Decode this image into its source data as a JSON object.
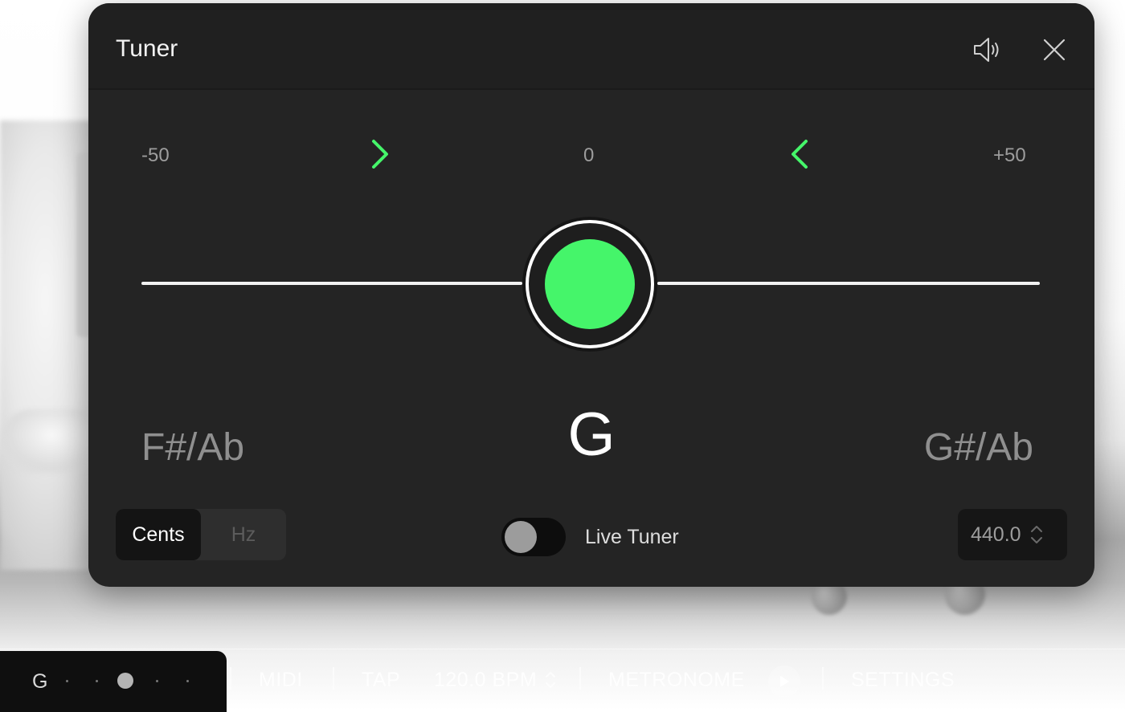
{
  "tuner": {
    "title": "Tuner",
    "scale": {
      "left": "-50",
      "center": "0",
      "right": "+50"
    },
    "deviation_cents": 0,
    "note": "G",
    "note_below": "F#/Ab",
    "note_above": "G#/Ab",
    "units": {
      "options": [
        "Cents",
        "Hz"
      ],
      "selected": "Cents"
    },
    "live_tuner": {
      "label": "Live Tuner",
      "on": false
    },
    "reference_pitch": "440.0",
    "colors": {
      "in_tune": "#45f56a",
      "panel": "#242424"
    },
    "icons": {
      "sound": "speaker-icon",
      "close": "close-icon"
    }
  },
  "bottombar": {
    "note": "G",
    "midi_label": "MIDI",
    "tap_label": "TAP",
    "bpm": "120.0 BPM",
    "metronome_label": "METRONOME",
    "settings_label": "SETTINGS"
  }
}
